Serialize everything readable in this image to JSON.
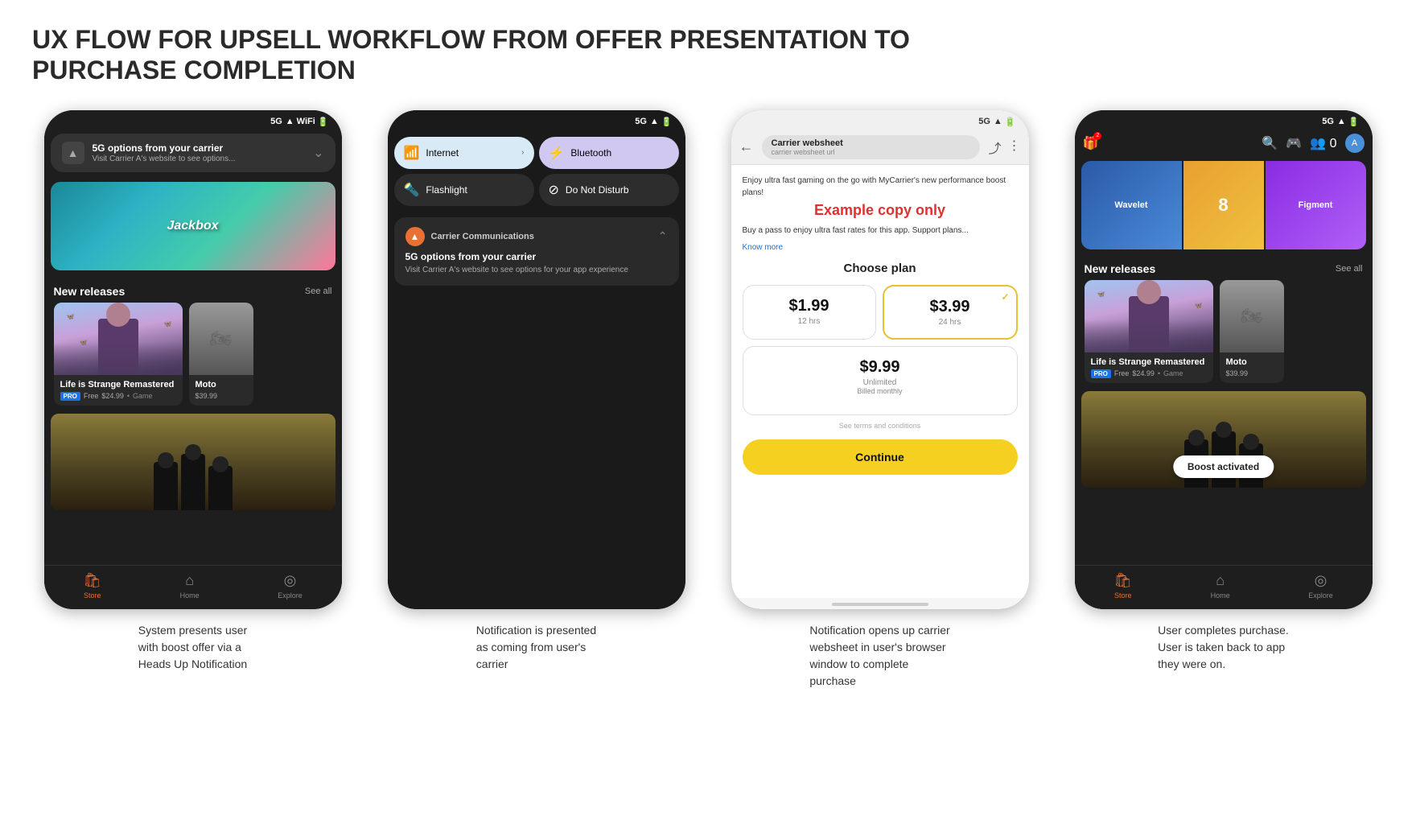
{
  "page": {
    "title": "UX FLOW FOR UPSELL WORKFLOW FROM OFFER PRESENTATION TO PURCHASE COMPLETION"
  },
  "steps": [
    {
      "id": "step1",
      "description": "System presents user\nwith boost offer via a\nHeads Up Notification"
    },
    {
      "id": "step2",
      "description": "Notification is presented\nas coming from user's\ncarrier"
    },
    {
      "id": "step3",
      "description": "Notification opens up carrier\nwebsheet in user's browser\nwindow to complete\npurchase"
    },
    {
      "id": "step4",
      "description": "User completes purchase.\nUser is taken back to app\nthey were on."
    }
  ],
  "screen1": {
    "status": "5G",
    "notification": {
      "title": "5G options from your carrier",
      "body": "Visit Carrier A's website to see options..."
    },
    "banner": "Jackbox",
    "section": "New releases",
    "see_all": "See all",
    "game1": {
      "title": "Life is Strange Remastered",
      "badge": "PRO",
      "price_label": "Free",
      "price_original": "$24.99",
      "type": "Game"
    },
    "game2": {
      "title": "Moto",
      "price": "$39.99"
    },
    "nav": {
      "store": "Store",
      "home": "Home",
      "explore": "Explore"
    }
  },
  "screen2": {
    "status": "5G",
    "tiles": {
      "internet": "Internet",
      "bluetooth": "Bluetooth",
      "flashlight": "Flashlight",
      "dnd": "Do Not Disturb"
    },
    "carrier_notification": {
      "app_name": "Carrier Communications",
      "title": "5G options from your carrier",
      "body": "Visit Carrier A's website to see options for your app experience"
    }
  },
  "screen3": {
    "status": "5G",
    "toolbar": {
      "site_name": "Carrier websheet",
      "url": "carrier websheet url"
    },
    "body_text": "Enjoy ultra fast gaming on the go with MyCarrier's new performance boost plans!",
    "body_text2": "Buy a pass to enjoy ultra fast rates for this app. Support plans...",
    "example_copy_label": "Example copy only",
    "know_more": "Know more",
    "choose_plan_title": "Choose plan",
    "plans": [
      {
        "price": "$1.99",
        "duration": "12 hrs"
      },
      {
        "price": "$3.99",
        "duration": "24 hrs",
        "selected": true
      }
    ],
    "plan_unlimited": {
      "price": "$9.99",
      "note1": "Unlimited",
      "note2": "Billed monthly"
    },
    "terms": "See terms and conditions",
    "continue_btn": "Continue"
  },
  "screen4": {
    "status": "5G",
    "boost_toast": "Boost activated",
    "section": "New releases",
    "see_all": "See all",
    "game1": {
      "title": "Life is Strange Remastered",
      "badge": "PRO",
      "price_label": "Free",
      "price_original": "$24.99",
      "type": "Game"
    },
    "game2": {
      "title": "Moto",
      "price": "$39.99"
    },
    "nav": {
      "store": "Store",
      "home": "Home",
      "explore": "Explore"
    }
  },
  "icons": {
    "store": "🛍",
    "home": "🏠",
    "explore": "🔍",
    "back": "←",
    "share": "⤴",
    "more": "⋮",
    "search": "🔍",
    "controller": "🎮",
    "people": "👥",
    "gift": "🎁",
    "wifi": "📶",
    "bluetooth_sym": "⚡",
    "flashlight_sym": "🔦",
    "dnd_sym": "⊘",
    "signal": "▲",
    "battery": "🔋",
    "check": "✓"
  }
}
